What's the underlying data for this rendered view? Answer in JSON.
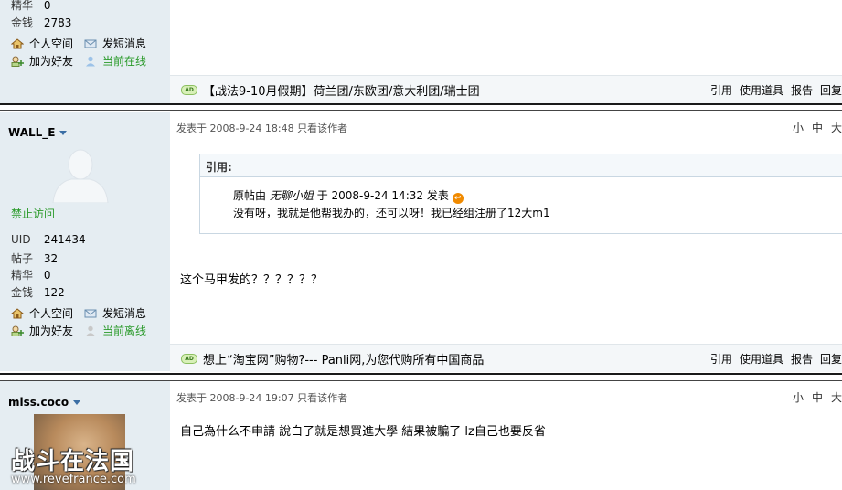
{
  "post1": {
    "stats": [
      {
        "label": "精华",
        "value": "0"
      },
      {
        "label": "金钱",
        "value": "2783"
      }
    ],
    "actions": {
      "profile": "个人空间",
      "message": "发短消息",
      "add_friend": "加为好友",
      "online": "当前在线"
    },
    "ad": "【战法9-10月假期】荷兰团/东欧团/意大利团/瑞士团",
    "ops": [
      "引用",
      "使用道具",
      "报告",
      "回复"
    ]
  },
  "post2": {
    "author": "WALL_E",
    "status": "禁止访问",
    "stats": [
      {
        "label": "UID",
        "value": "241434"
      },
      {
        "label": "帖子",
        "value": "32"
      },
      {
        "label": "精华",
        "value": "0"
      },
      {
        "label": "金钱",
        "value": "122"
      }
    ],
    "actions": {
      "profile": "个人空间",
      "message": "发短消息",
      "add_friend": "加为好友",
      "offline": "当前离线"
    },
    "meta": "发表于  2008-9-24 18:48  只看该作者",
    "font_sizes": [
      "小",
      "中",
      "大"
    ],
    "quote": {
      "header": "引用:",
      "line1_prefix": "原帖由",
      "quoted_author": "无聊小姐",
      "line1_suffix": "于  2008-9-24 14:32 发表",
      "line2": "没有呀，我就是他帮我办的，还可以呀！我已经组注册了12大m1"
    },
    "content": "这个马甲发的？？？？？？",
    "ad": "想上“淘宝网”购物?--- Panli网,为您代购所有中国商品",
    "ops": [
      "引用",
      "使用道具",
      "报告",
      "回复"
    ]
  },
  "post3": {
    "author": "miss.coco",
    "meta": "发表于  2008-9-24 19:07  只看该作者",
    "font_sizes": [
      "小",
      "中",
      "大"
    ],
    "content": "自己為什么不申請  說白了就是想買進大學  結果被騙了  lz自己也要反省"
  },
  "watermark": {
    "line1": "战斗在法国",
    "line2": "www.revefrance.com"
  }
}
